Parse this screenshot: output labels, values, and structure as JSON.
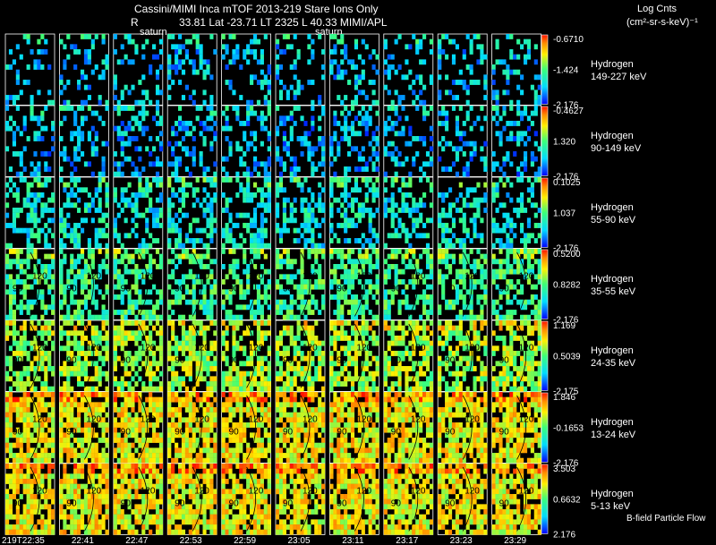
{
  "header": {
    "title": "Cassini/MIMI Inca mTOF  2013-219   Stare   Ions Only",
    "r_label": "R",
    "info": "33.81 Lat -23.71 LT 2325 L        40.33  MIMI/APL",
    "saturn_label_1": "saturn",
    "saturn_label_2": "saturn",
    "units_line1": "Log Cnts",
    "units_line2": "(cm²-sr-s-keV)⁻¹"
  },
  "footer": {
    "bfield_label": "B-field  Particle Flow"
  },
  "chart_data": {
    "type": "heatmap",
    "time_labels": [
      "219T22:35",
      "22:41",
      "22:47",
      "22:53",
      "22:59",
      "23:05",
      "23:11",
      "23:17",
      "23:23",
      "23:29"
    ],
    "rows": [
      {
        "species": "Hydrogen",
        "energy": "149-227 keV",
        "scale_max": "-0.6710",
        "scale_mid": "-1.424",
        "scale_min": "-2.176",
        "density": 0.28,
        "level": 0.25
      },
      {
        "species": "Hydrogen",
        "energy": "90-149 keV",
        "scale_max": "-0.4627",
        "scale_mid": "1.320",
        "scale_min": "-2.176",
        "density": 0.35,
        "level": 0.22
      },
      {
        "species": "Hydrogen",
        "energy": "55-90 keV",
        "scale_max": "0.1025",
        "scale_mid": "1.037",
        "scale_min": "-2.176",
        "density": 0.45,
        "level": 0.33
      },
      {
        "species": "Hydrogen",
        "energy": "35-55 keV",
        "scale_max": "0.5200",
        "scale_mid": "0.8282",
        "scale_min": "-2.176",
        "density": 0.55,
        "level": 0.45
      },
      {
        "species": "Hydrogen",
        "energy": "24-35 keV",
        "scale_max": "1.169",
        "scale_mid": "0.5039",
        "scale_min": "-2.175",
        "density": 0.65,
        "level": 0.6
      },
      {
        "species": "Hydrogen",
        "energy": "13-24 keV",
        "scale_max": "1.846",
        "scale_mid": "-0.1653",
        "scale_min": "-2.176",
        "density": 0.78,
        "level": 0.72
      },
      {
        "species": "Hydrogen",
        "energy": "5-13 keV",
        "scale_max": "3.503",
        "scale_mid": "0.6632",
        "scale_min": "2.176",
        "density": 0.8,
        "level": 0.72
      }
    ],
    "pitch_labels": [
      "90",
      "120"
    ],
    "pitch_label_start_row": 3
  }
}
